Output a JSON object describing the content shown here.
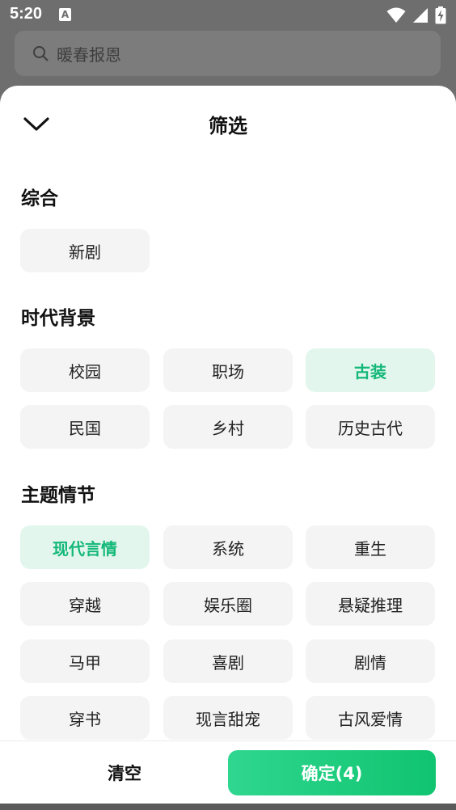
{
  "status_bar": {
    "time": "5:20",
    "notification_badge": "A"
  },
  "search": {
    "placeholder": "暖春报恩"
  },
  "sheet": {
    "title": "筛选",
    "sections": [
      {
        "title": "综合",
        "options": [
          {
            "label": "新剧",
            "selected": false
          }
        ]
      },
      {
        "title": "时代背景",
        "options": [
          {
            "label": "校园",
            "selected": false
          },
          {
            "label": "职场",
            "selected": false
          },
          {
            "label": "古装",
            "selected": true
          },
          {
            "label": "民国",
            "selected": false
          },
          {
            "label": "乡村",
            "selected": false
          },
          {
            "label": "历史古代",
            "selected": false
          }
        ]
      },
      {
        "title": "主题情节",
        "options": [
          {
            "label": "现代言情",
            "selected": true
          },
          {
            "label": "系统",
            "selected": false
          },
          {
            "label": "重生",
            "selected": false
          },
          {
            "label": "穿越",
            "selected": false
          },
          {
            "label": "娱乐圈",
            "selected": false
          },
          {
            "label": "悬疑推理",
            "selected": false
          },
          {
            "label": "马甲",
            "selected": false
          },
          {
            "label": "喜剧",
            "selected": false
          },
          {
            "label": "剧情",
            "selected": false
          },
          {
            "label": "穿书",
            "selected": false
          },
          {
            "label": "现言甜宠",
            "selected": false
          },
          {
            "label": "古风爱情",
            "selected": false
          }
        ]
      }
    ]
  },
  "footer": {
    "clear_label": "清空",
    "confirm_label": "确定(4)"
  },
  "colors": {
    "accent": "#14b878",
    "selected_bg": "#e3f6ee",
    "chip_bg": "#f4f4f4",
    "scrim": "#6e6e6e"
  }
}
